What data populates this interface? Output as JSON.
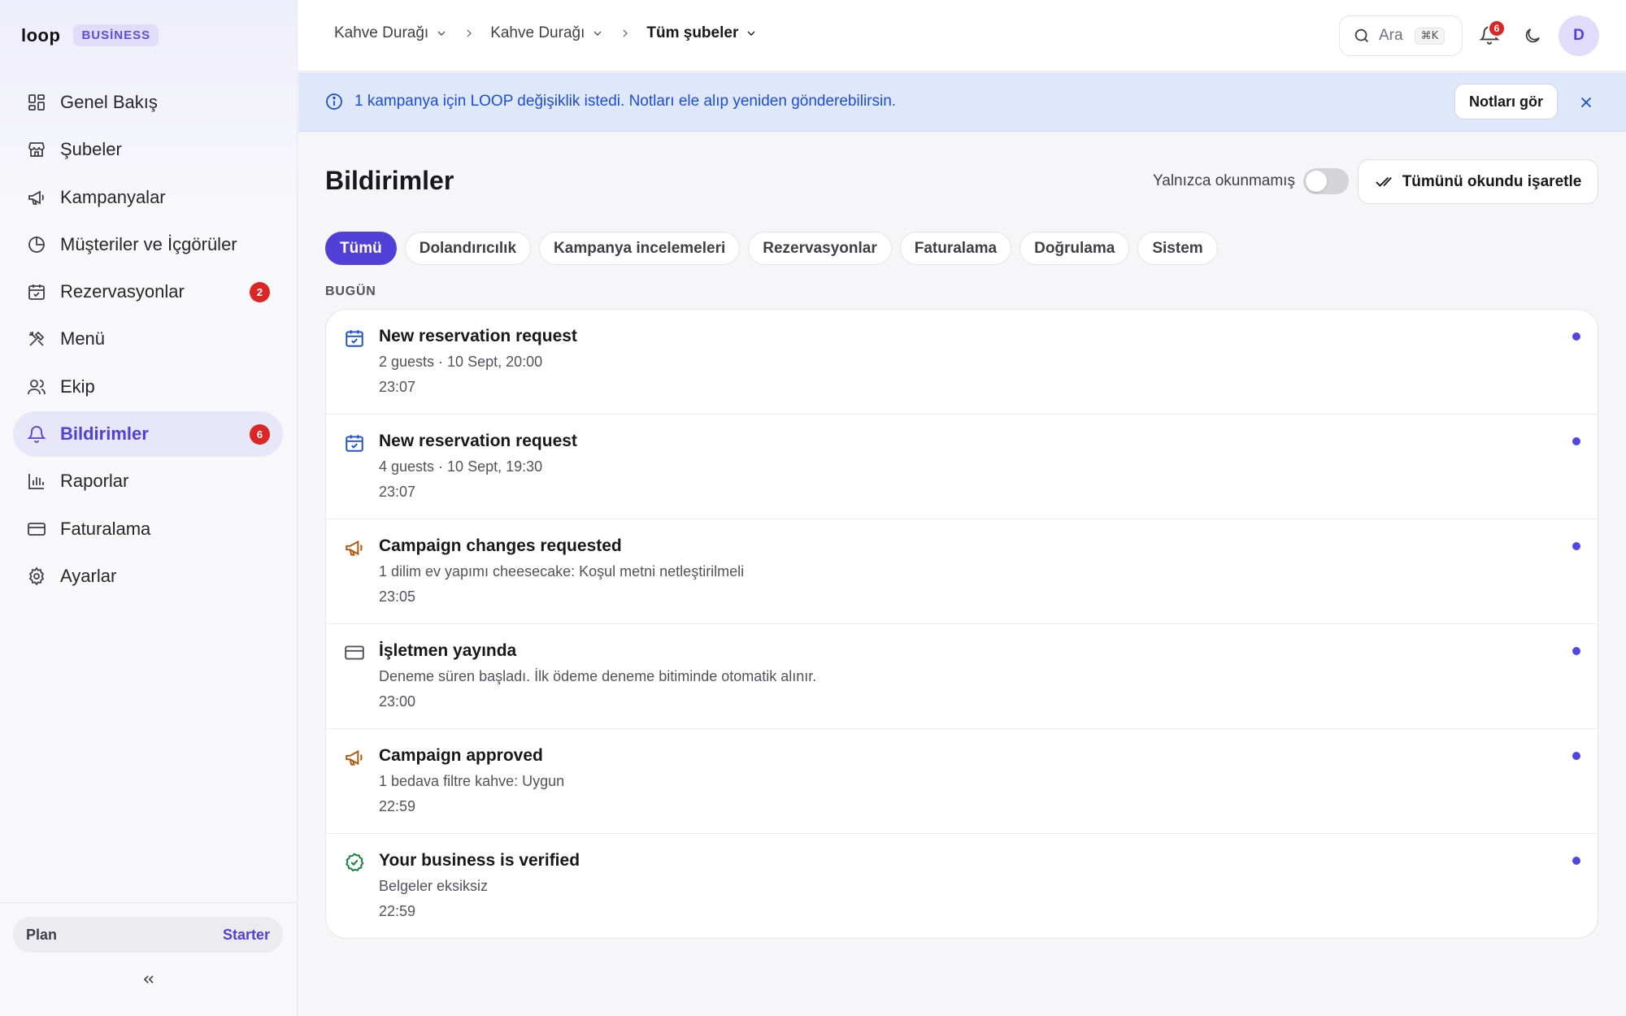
{
  "brand": {
    "logo": "loop",
    "badge": "BUSİNESS"
  },
  "sidebar": {
    "items": [
      {
        "label": "Genel Bakış",
        "icon": "dashboard-icon"
      },
      {
        "label": "Şubeler",
        "icon": "store-icon"
      },
      {
        "label": "Kampanyalar",
        "icon": "megaphone-icon"
      },
      {
        "label": "Müşteriler ve İçgörüler",
        "icon": "pie-chart-icon"
      },
      {
        "label": "Rezervasyonlar",
        "icon": "calendar-check-icon",
        "badge": "2"
      },
      {
        "label": "Menü",
        "icon": "utensils-icon"
      },
      {
        "label": "Ekip",
        "icon": "users-icon"
      },
      {
        "label": "Bildirimler",
        "icon": "bell-icon",
        "badge": "6",
        "active": true
      },
      {
        "label": "Raporlar",
        "icon": "bar-chart-icon"
      },
      {
        "label": "Faturalama",
        "icon": "credit-card-icon"
      },
      {
        "label": "Ayarlar",
        "icon": "gear-icon"
      }
    ],
    "plan": {
      "label": "Plan",
      "value": "Starter"
    }
  },
  "topbar": {
    "breadcrumbs": [
      "Kahve Durağı",
      "Kahve Durağı",
      "Tüm şubeler"
    ],
    "search": {
      "label": "Ara",
      "shortcut": "⌘K"
    },
    "notifications_count": "6",
    "avatar": "D"
  },
  "banner": {
    "text": "1 kampanya için LOOP değişiklik istedi. Notları ele alıp yeniden gönderebilirsin.",
    "button": "Notları gör"
  },
  "main": {
    "title": "Bildirimler",
    "unread_only_label": "Yalnızca okunmamış",
    "unread_only": false,
    "mark_all_label": "Tümünü okundu işaretle",
    "tabs": [
      "Tümü",
      "Dolandırıcılık",
      "Kampanya incelemeleri",
      "Rezervasyonlar",
      "Faturalama",
      "Doğrulama",
      "Sistem"
    ],
    "active_tab": "Tümü",
    "section_label": "BUGÜN",
    "notifications": [
      {
        "icon": "calendar-check-icon",
        "title": "New reservation request",
        "desc": "2 guests · 10 Sept, 20:00",
        "time": "23:07",
        "unread": true
      },
      {
        "icon": "calendar-check-icon",
        "title": "New reservation request",
        "desc": "4 guests · 10 Sept, 19:30",
        "time": "23:07",
        "unread": true
      },
      {
        "icon": "megaphone-icon",
        "title": "Campaign changes requested",
        "desc": "1 dilim ev yapımı cheesecake: Koşul metni netleştirilmeli",
        "time": "23:05",
        "unread": true
      },
      {
        "icon": "credit-card-icon",
        "title": "İşletmen yayında",
        "desc": "Deneme süren başladı. İlk ödeme deneme bitiminde otomatik alınır.",
        "time": "23:00",
        "unread": true
      },
      {
        "icon": "megaphone-icon",
        "title": "Campaign approved",
        "desc": "1 bedava filtre kahve: Uygun",
        "time": "22:59",
        "unread": true
      },
      {
        "icon": "check-circle-icon",
        "title": "Your business is verified",
        "desc": "Belgeler eksiksiz",
        "time": "22:59",
        "unread": true
      }
    ]
  },
  "colors": {
    "accent": "#5140d8",
    "badge": "#dc2626",
    "banner_bg": "#dfe7fb",
    "banner_text": "#1d4ed8",
    "calendar_icon": "#1d4ed8",
    "megaphone_icon": "#b45309",
    "check_icon": "#15803d",
    "card_icon": "#52525b"
  }
}
